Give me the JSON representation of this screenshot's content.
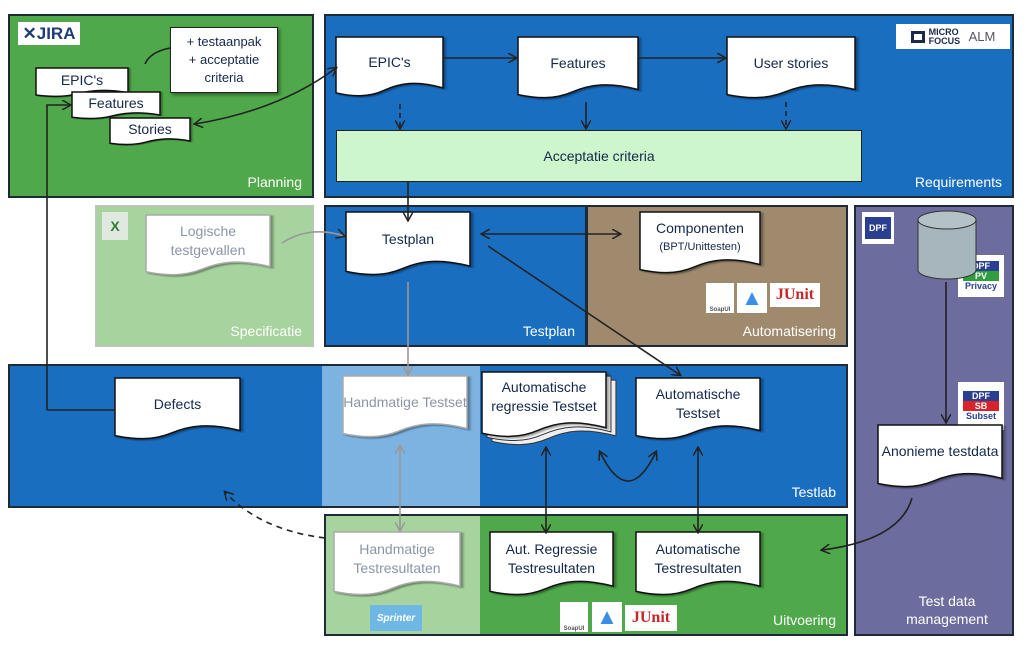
{
  "panels": {
    "planning": "Planning",
    "requirements": "Requirements",
    "specificatie": "Specificatie",
    "testplan": "Testplan",
    "automatisering": "Automatisering",
    "testdata": "Test data management",
    "testlab": "Testlab",
    "uitvoering": "Uitvoering"
  },
  "colors": {
    "green": "#4fa84a",
    "light_green": "#a6d39e",
    "blue": "#1a6ec0",
    "light_blue": "#7db3e0",
    "brown": "#a08a6e",
    "purple": "#6c6c9f",
    "acceptance": "#cdf6cd"
  },
  "logos": {
    "jira": "JIRA",
    "microfocus": "MICRO FOCUS",
    "alm": "ALM",
    "excel": "X",
    "dpf": "DPF",
    "dpf_pv": "PV",
    "privacy": "Privacy",
    "dpf_sb": "SB",
    "subset": "Subset",
    "soapui": "SoapUI",
    "junit": "JUnit",
    "sprinter": "Sprinter"
  },
  "planning": {
    "epics": "EPIC's",
    "features": "Features",
    "stories": "Stories",
    "note": [
      "+ testaanpak",
      "+ acceptatie",
      "criteria"
    ]
  },
  "requirements": {
    "epics": "EPIC's",
    "features": "Features",
    "user_stories": "User stories",
    "acceptance": "Acceptatie criteria"
  },
  "docs": {
    "logische": "Logische testgevallen",
    "testplan": "Testplan",
    "componenten": "Componenten",
    "componenten_sub": "(BPT/Unittesten)",
    "defects": "Defects",
    "handmatige_testset": "Handmatige Testset",
    "auto_regressie_testset": "Automatische regressie Testset",
    "auto_testset": "Automatische Testset",
    "anonieme": "Anonieme testdata",
    "handmatige_resultaten": "Handmatige Testresultaten",
    "aut_regressie_resultaten": "Aut. Regressie Testresultaten",
    "auto_resultaten": "Automatische Testresultaten"
  }
}
